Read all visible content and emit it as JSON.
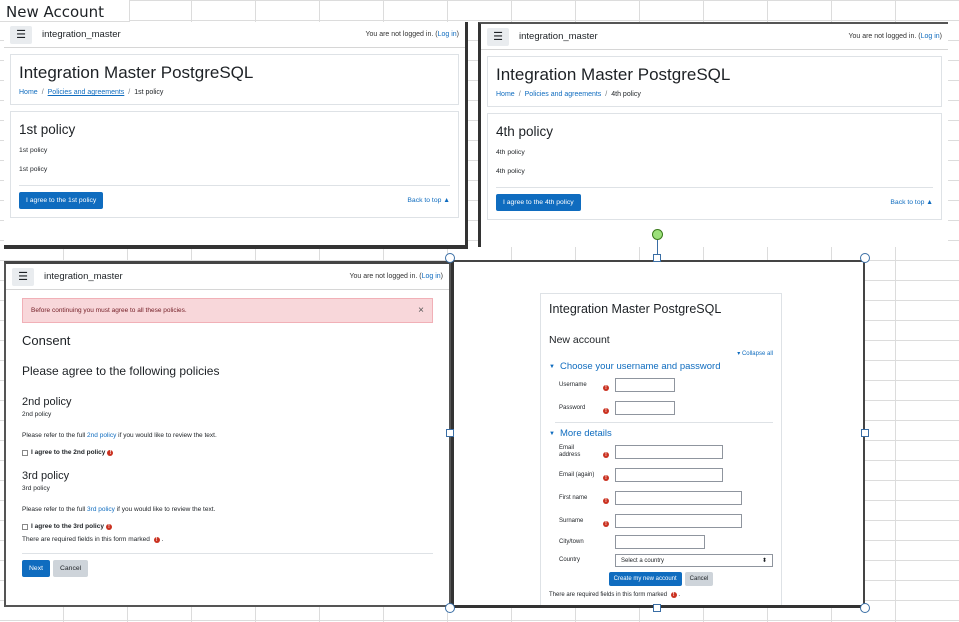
{
  "sheet": {
    "cell_a1": "New Account"
  },
  "p1": {
    "site_name": "integration_master",
    "login_text": "You are not logged in. (",
    "login_link": "Log in",
    "login_close": ")",
    "page_title": "Integration Master PostgreSQL",
    "crumbs": {
      "home": "Home",
      "sep": "/",
      "policies": "Policies and agreements",
      "current": "1st policy"
    },
    "policy_title": "1st policy",
    "summary": "1st policy",
    "content": "1st policy",
    "agree_button": "I agree to the 1st policy",
    "back_to_top": "Back to top ▲"
  },
  "p2": {
    "site_name": "integration_master",
    "login_text": "You are not logged in. (",
    "login_link": "Log in",
    "login_close": ")",
    "page_title": "Integration Master PostgreSQL",
    "crumbs": {
      "home": "Home",
      "sep": "/",
      "policies": "Policies and agreements",
      "current": "4th policy"
    },
    "policy_title": "4th policy",
    "summary": "4th policy",
    "content": "4th policy",
    "agree_button": "I agree to the 4th policy",
    "back_to_top": "Back to top ▲"
  },
  "p3": {
    "site_name": "integration_master",
    "login_text": "You are not logged in. (",
    "login_link": "Log in",
    "login_close": ")",
    "alert": "Before continuing you must agree to all these policies.",
    "alert_close": "×",
    "consent_title": "Consent",
    "agree_heading": "Please agree to the following policies",
    "policies": [
      {
        "title": "2nd policy",
        "summary": "2nd policy",
        "refer_prefix": "Please refer to the full ",
        "refer_link": "2nd policy",
        "refer_suffix": " if you would like to review the text.",
        "checkbox_label": "I agree to the 2nd policy"
      },
      {
        "title": "3rd policy",
        "summary": "3rd policy",
        "refer_prefix": "Please refer to the full ",
        "refer_link": "3rd policy",
        "refer_suffix": " if you would like to review the text.",
        "checkbox_label": "I agree to the 3rd policy"
      }
    ],
    "required_note": "There are required fields in this form marked",
    "next_button": "Next",
    "cancel_button": "Cancel"
  },
  "p4": {
    "site_title": "Integration Master PostgreSQL",
    "form_title": "New account",
    "collapse_all": "Collapse all",
    "section1": "Choose your username and password",
    "section2": "More details",
    "fields": {
      "username": "Username",
      "password": "Password",
      "email": "Email address",
      "email_again": "Email (again)",
      "first_name": "First name",
      "surname": "Surname",
      "city": "City/town",
      "country": "Country"
    },
    "country_placeholder": "Select a country",
    "create_button": "Create my new account",
    "cancel_button": "Cancel",
    "required_note": "There are required fields in this form marked"
  },
  "icons": {
    "menu": "hamburger-menu-icon",
    "required": "exclamation-circle-icon",
    "close": "close-icon",
    "caret": "caret-down-icon"
  },
  "colors": {
    "primary": "#0f6cbf",
    "required": "#ca3120",
    "alert_bg": "#f8d7da",
    "selection_handle": "#3a6ea5",
    "rotate_handle": "#9ce07a"
  }
}
